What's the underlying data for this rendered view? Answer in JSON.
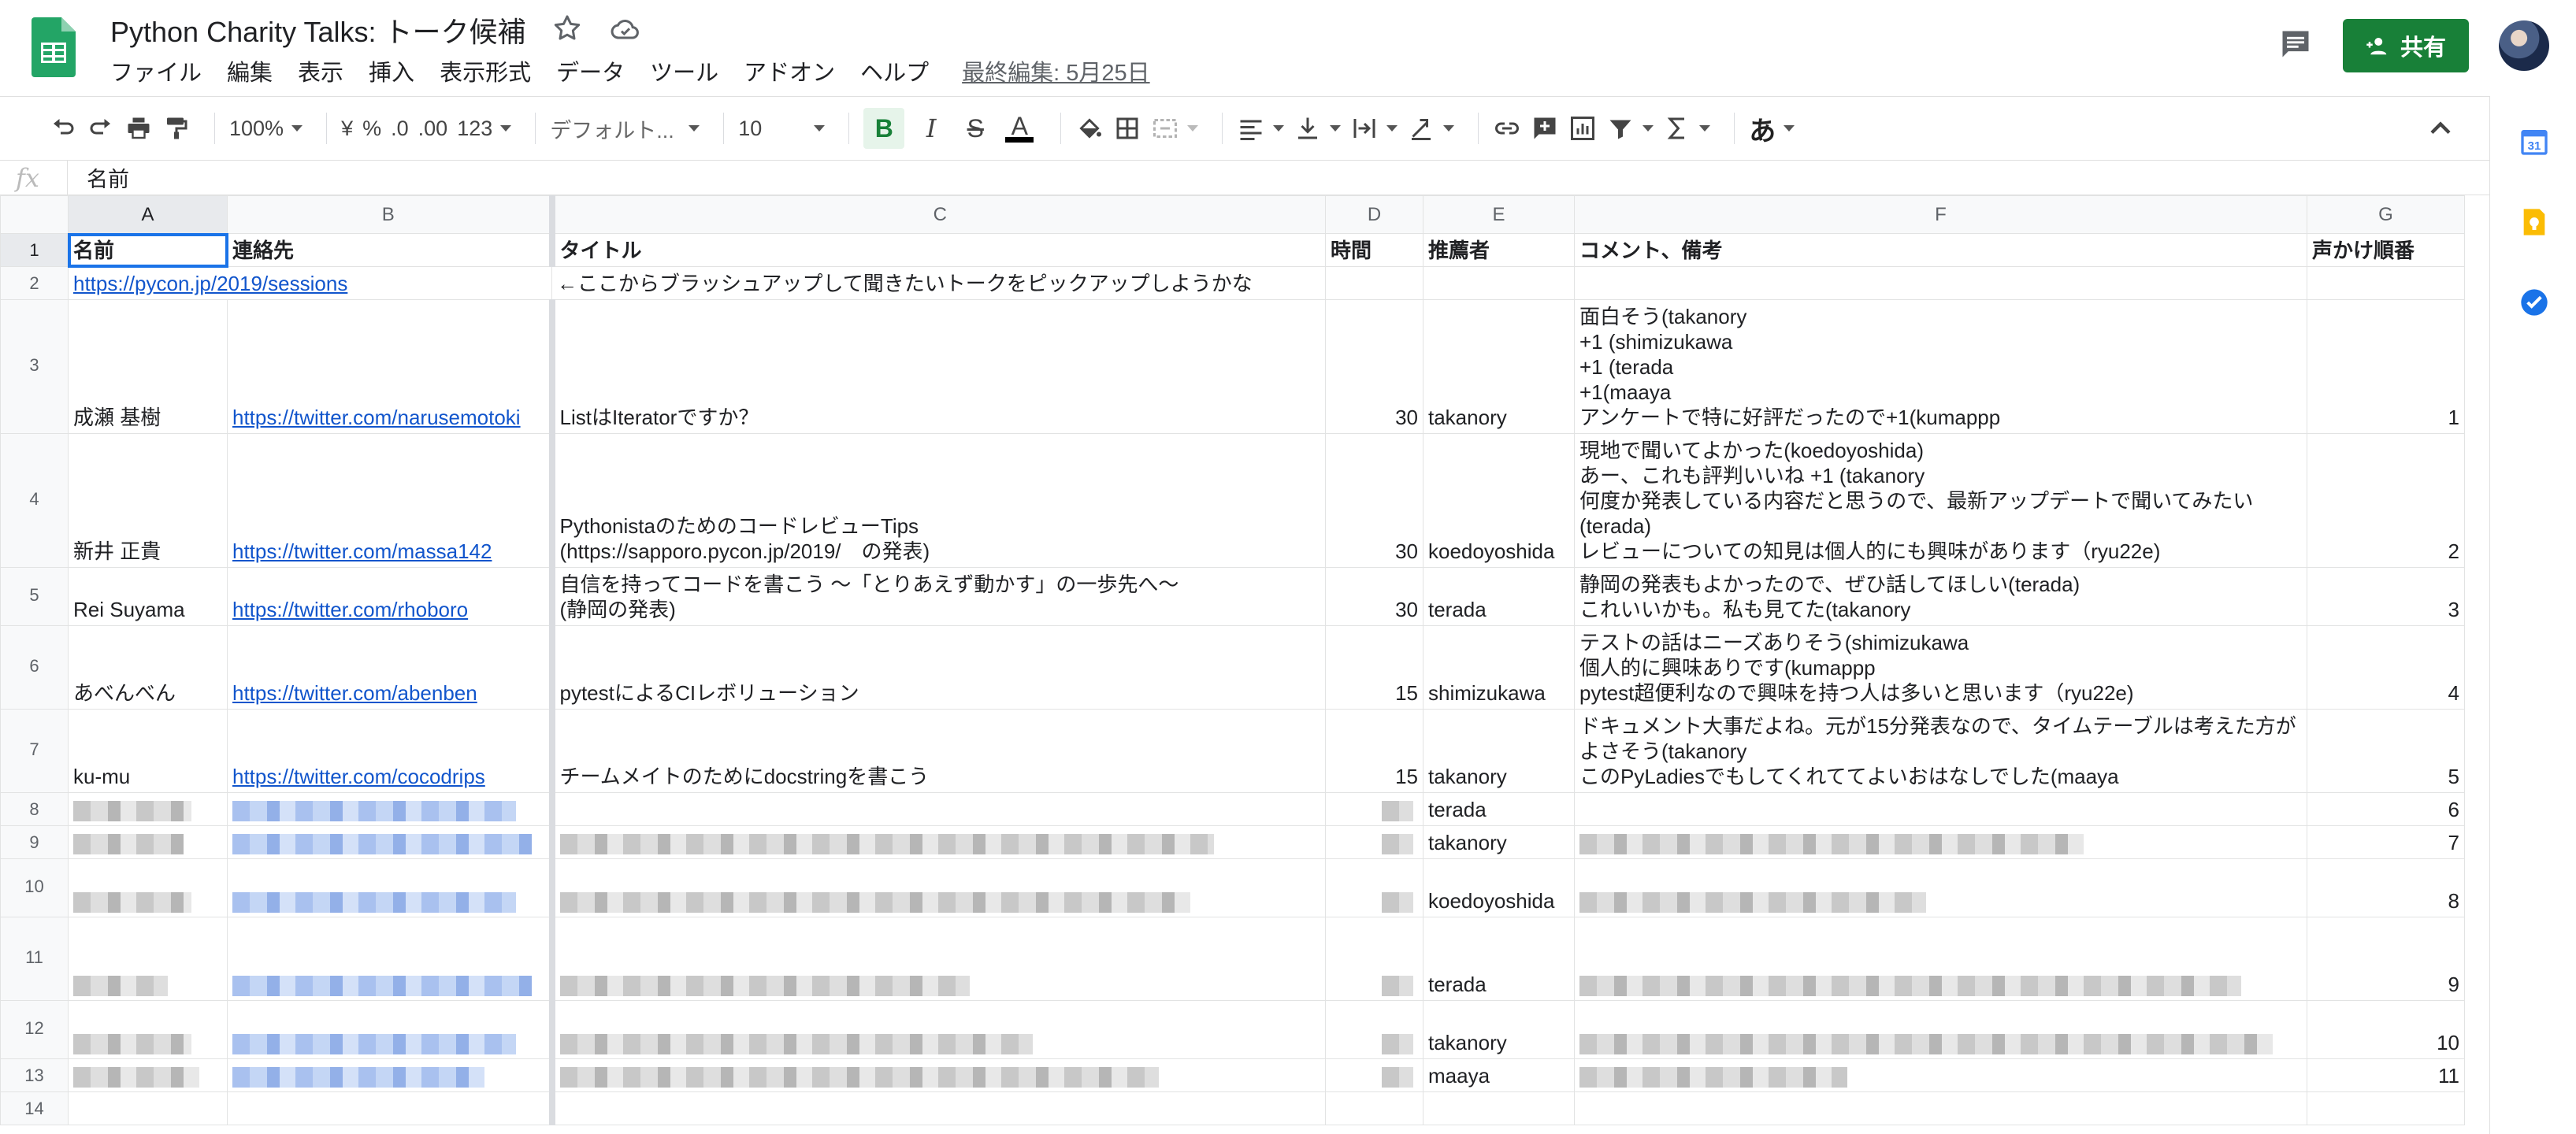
{
  "header": {
    "title": "Python Charity Talks: トーク候補",
    "menu": [
      "ファイル",
      "編集",
      "表示",
      "挿入",
      "表示形式",
      "データ",
      "ツール",
      "アドオン",
      "ヘルプ"
    ],
    "last_edit": "最終編集: 5月25日",
    "share_label": "共有"
  },
  "toolbar": {
    "zoom": "100%",
    "currency": "¥",
    "percent": "%",
    "dec_decrease": ".0",
    "dec_increase": ".00",
    "more_formats": "123",
    "font": "デフォルト...",
    "font_size": "10",
    "bold": "B",
    "italic": "I",
    "strike": "S",
    "text_color": "A",
    "input_tools": "あ"
  },
  "formula_bar": {
    "fx": "fx",
    "value": "名前"
  },
  "columns": [
    "A",
    "B",
    "C",
    "D",
    "E",
    "F",
    "G"
  ],
  "rows": [
    {
      "n": "1",
      "a": "名前",
      "b": "連絡先",
      "c": "タイトル",
      "d": "時間",
      "e": "推薦者",
      "f": "コメント、備考",
      "g": "声かけ順番"
    },
    {
      "n": "2",
      "a": "https://pycon.jp/2019/sessions",
      "b": "",
      "c": "←ここからブラッシュアップして聞きたいトークをピックアップしようかな",
      "d": "",
      "e": "",
      "f": "",
      "g": ""
    },
    {
      "n": "3",
      "a": "成瀬 基樹",
      "b": "https://twitter.com/narusemotoki",
      "c": "ListはIteratorですか？",
      "d": "30",
      "e": "takanory",
      "f": "面白そう(takanory\n+1 (shimizukawa\n+1 (terada\n+1(maaya\nアンケートで特に好評だったので+1(kumappp",
      "g": "1"
    },
    {
      "n": "4",
      "a": "新井 正貴",
      "b": "https://twitter.com/massa142",
      "c": "PythonistaのためのコードレビューTips\n(https://sapporo.pycon.jp/2019/　の発表)",
      "d": "30",
      "e": "koedoyoshida",
      "f": "現地で聞いてよかった(koedoyoshida)\nあー、これも評判いいね +1 (takanory\n何度か発表している内容だと思うので、最新アップデートで聞いてみたい\n(terada)\nレビューについての知見は個人的にも興味があります（ryu22e)",
      "g": "2"
    },
    {
      "n": "5",
      "a": "Rei Suyama",
      "b": "https://twitter.com/rhoboro",
      "c": "自信を持ってコードを書こう 〜「とりあえず動かす」の一歩先へ〜\n(静岡の発表)",
      "d": "30",
      "e": "terada",
      "f": "静岡の発表もよかったので、ぜひ話してほしい(terada)\nこれいいかも。私も見てた(takanory",
      "g": "3"
    },
    {
      "n": "6",
      "a": "あべんべん",
      "b": "https://twitter.com/abenben",
      "c": "pytestによるCIレボリューション",
      "d": "15",
      "e": "shimizukawa",
      "f": "テストの話はニーズありそう(shimizukawa\n個人的に興味ありです(kumappp\npytest超便利なので興味を持つ人は多いと思います（ryu22e)",
      "g": "4"
    },
    {
      "n": "7",
      "a": "ku-mu",
      "b": "https://twitter.com/cocodrips",
      "c": "チームメイトのためにdocstringを書こう",
      "d": "15",
      "e": "takanory",
      "f": "ドキュメント大事だよね。元が15分発表なので、タイムテーブルは考えた方が\nよさそう(takanory\nこのPyLadiesでもしてくれててよいおはなしでした(maaya",
      "g": "5"
    },
    {
      "n": "8",
      "e": "terada",
      "g": "6"
    },
    {
      "n": "9",
      "e": "takanory",
      "g": "7"
    },
    {
      "n": "10",
      "e": "koedoyoshida",
      "g": "8"
    },
    {
      "n": "11",
      "e": "terada",
      "g": "9"
    },
    {
      "n": "12",
      "e": "takanory",
      "g": "10"
    },
    {
      "n": "13",
      "e": "maaya",
      "g": "11"
    },
    {
      "n": "14",
      "e": "",
      "g": ""
    }
  ]
}
